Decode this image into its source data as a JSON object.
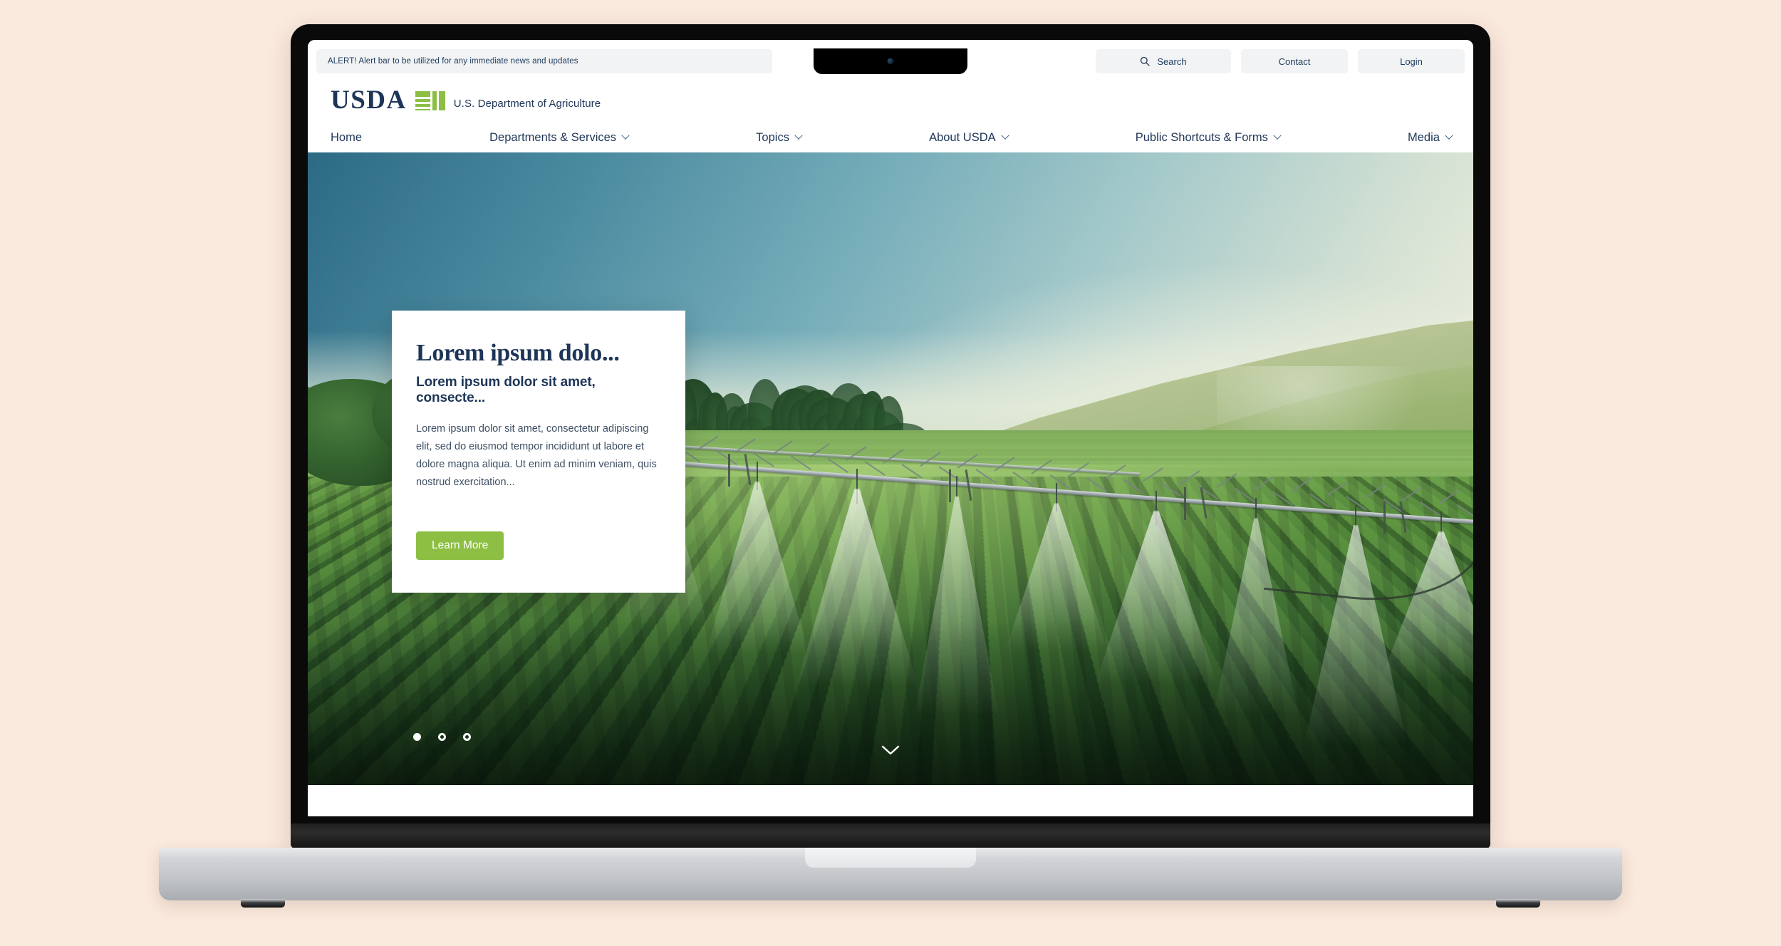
{
  "device": {
    "type": "laptop",
    "camera": "camera-dot"
  },
  "utility": {
    "alert_text": "ALERT! Alert bar to be utilized for any immediate news and updates",
    "search_label": "Search",
    "search_icon": "search-icon",
    "contact_label": "Contact",
    "login_label": "Login"
  },
  "brand": {
    "wordmark": "USDA",
    "agency_name": "U.S. Department of Agriculture",
    "logo_mark": "usda-leaf-bars-mark"
  },
  "nav": {
    "items": [
      {
        "label": "Home",
        "has_dropdown": false
      },
      {
        "label": "Departments & Services",
        "has_dropdown": true
      },
      {
        "label": "Topics",
        "has_dropdown": true
      },
      {
        "label": "About USDA",
        "has_dropdown": true
      },
      {
        "label": "Public Shortcuts & Forms",
        "has_dropdown": true
      },
      {
        "label": "Media",
        "has_dropdown": true
      }
    ]
  },
  "hero": {
    "image_alt": "center pivot irrigation sprinklers watering green crop field with rolling hills",
    "card": {
      "title": "Lorem ipsum dolo...",
      "subtitle": "Lorem ipsum dolor sit amet, consecte...",
      "body": "Lorem ipsum dolor sit amet, consectetur adipiscing elit, sed do eiusmod tempor incididunt ut labore et dolore magna aliqua. Ut enim ad minim veniam, quis nostrud exercitation...",
      "button_label": "Learn More"
    },
    "carousel": {
      "slides": 3,
      "active_index": 0
    },
    "scroll_icon": "chevron-down-icon"
  },
  "colors": {
    "page_background": "#fae9dd",
    "brand_navy": "#1d3557",
    "brand_green": "#8cbf43",
    "utility_chip": "#f2f3f4",
    "card_background": "#ffffff"
  }
}
